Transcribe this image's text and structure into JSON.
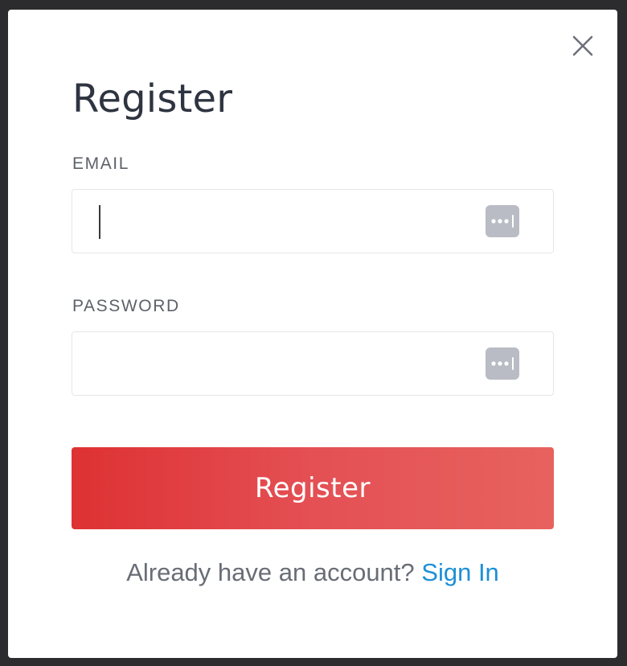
{
  "modal": {
    "title": "Register",
    "close_icon": "close-icon"
  },
  "form": {
    "email": {
      "label": "EMAIL",
      "value": "",
      "placeholder": ""
    },
    "password": {
      "label": "PASSWORD",
      "value": "",
      "placeholder": ""
    },
    "password_manager_icon": "password-manager-icon",
    "submit_label": "Register"
  },
  "footer": {
    "prompt_text": "Already have an account?",
    "link_text": "Sign In"
  },
  "colors": {
    "title": "#2f3441",
    "button_gradient_start": "#de3133",
    "button_gradient_end": "#e7625f",
    "link": "#1d8fd6",
    "backdrop": "#2c2c2e"
  }
}
